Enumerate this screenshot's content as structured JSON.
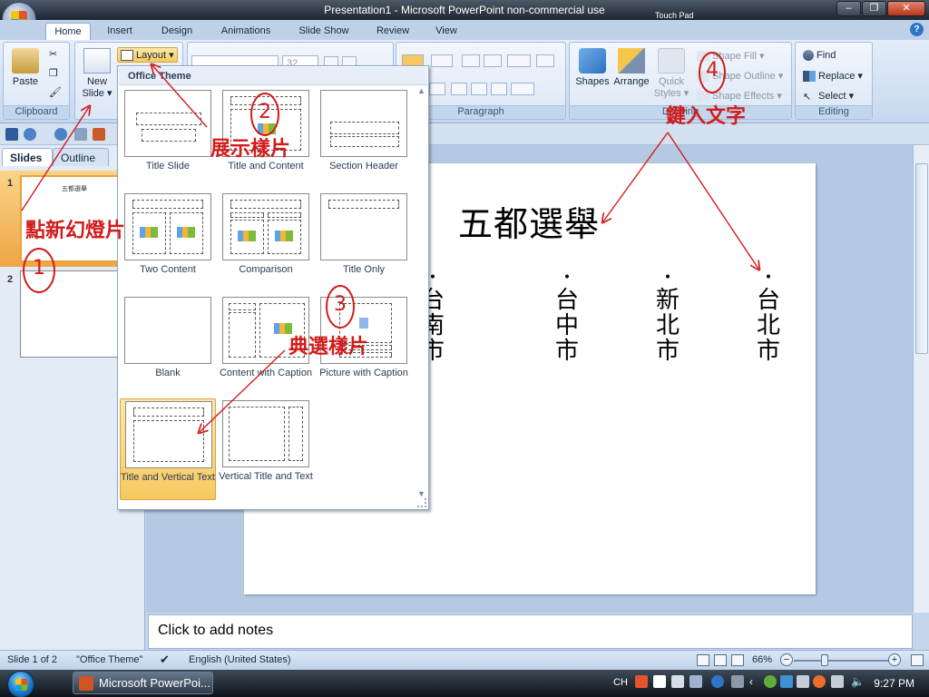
{
  "window": {
    "title": "Presentation1 - Microsoft PowerPoint non-commercial use",
    "touchpad_label": "Touch Pad"
  },
  "tabs": [
    "Home",
    "Insert",
    "Design",
    "Animations",
    "Slide Show",
    "Review",
    "View"
  ],
  "ribbon": {
    "clipboard": {
      "paste": "Paste",
      "label": "Clipboard"
    },
    "slides": {
      "new_slide_line1": "New",
      "new_slide_line2": "Slide ▾",
      "layout": "Layout ▾"
    },
    "font": {
      "size": "32"
    },
    "paragraph": {
      "label": "Paragraph"
    },
    "drawing": {
      "shapes": "Shapes",
      "arrange": "Arrange",
      "quick_styles_line1": "Quick",
      "quick_styles_line2": "Styles ▾",
      "shape_fill": "Shape Fill ▾",
      "shape_outline": "Shape Outline ▾",
      "shape_effects": "Shape Effects ▾",
      "label": "Drawing"
    },
    "editing": {
      "find": "Find",
      "replace": "Replace ▾",
      "select": "Select ▾",
      "label": "Editing"
    }
  },
  "slides_panel": {
    "tab_slides": "Slides",
    "tab_outline": "Outline",
    "close": "x",
    "slides": [
      {
        "number": "1",
        "title": "五都選舉"
      },
      {
        "number": "2"
      }
    ]
  },
  "layout_gallery": {
    "header": "Office Theme",
    "items": [
      "Title Slide",
      "Title and Content",
      "Section Header",
      "Two Content",
      "Comparison",
      "Title Only",
      "Blank",
      "Content with Caption",
      "Picture with Caption",
      "Title and Vertical Text",
      "Vertical Title and Text"
    ],
    "selected": "Title and Vertical Text"
  },
  "slide": {
    "title": "五都選舉",
    "bullet": "•",
    "columns": [
      {
        "chars": [
          "台",
          "南",
          "市"
        ]
      },
      {
        "chars": [
          "台",
          "中",
          "市"
        ]
      },
      {
        "chars": [
          "新",
          "北",
          "市"
        ]
      },
      {
        "chars": [
          "台",
          "北",
          "市"
        ]
      }
    ]
  },
  "notes": {
    "placeholder": "Click to add notes"
  },
  "status": {
    "slide_count": "Slide 1 of 2",
    "theme": "\"Office Theme\"",
    "language": "English (United States)",
    "zoom": "66%",
    "zoom_minus": "−",
    "zoom_plus": "+"
  },
  "taskbar": {
    "app_button": "Microsoft PowerPoi...",
    "input_lang": "CH",
    "clock": "9:27 PM"
  },
  "annotations": {
    "step1": "1",
    "step2": "2",
    "step3": "3",
    "step4": "4",
    "label1": "點新幻燈片",
    "label2": "展示樣片",
    "label3": "典選樣片",
    "label4": "鍵入文字"
  },
  "colors": {
    "annotation": "#d21b1b",
    "selected_layout": "#f7c860",
    "ribbon": "#dbe7f5"
  }
}
